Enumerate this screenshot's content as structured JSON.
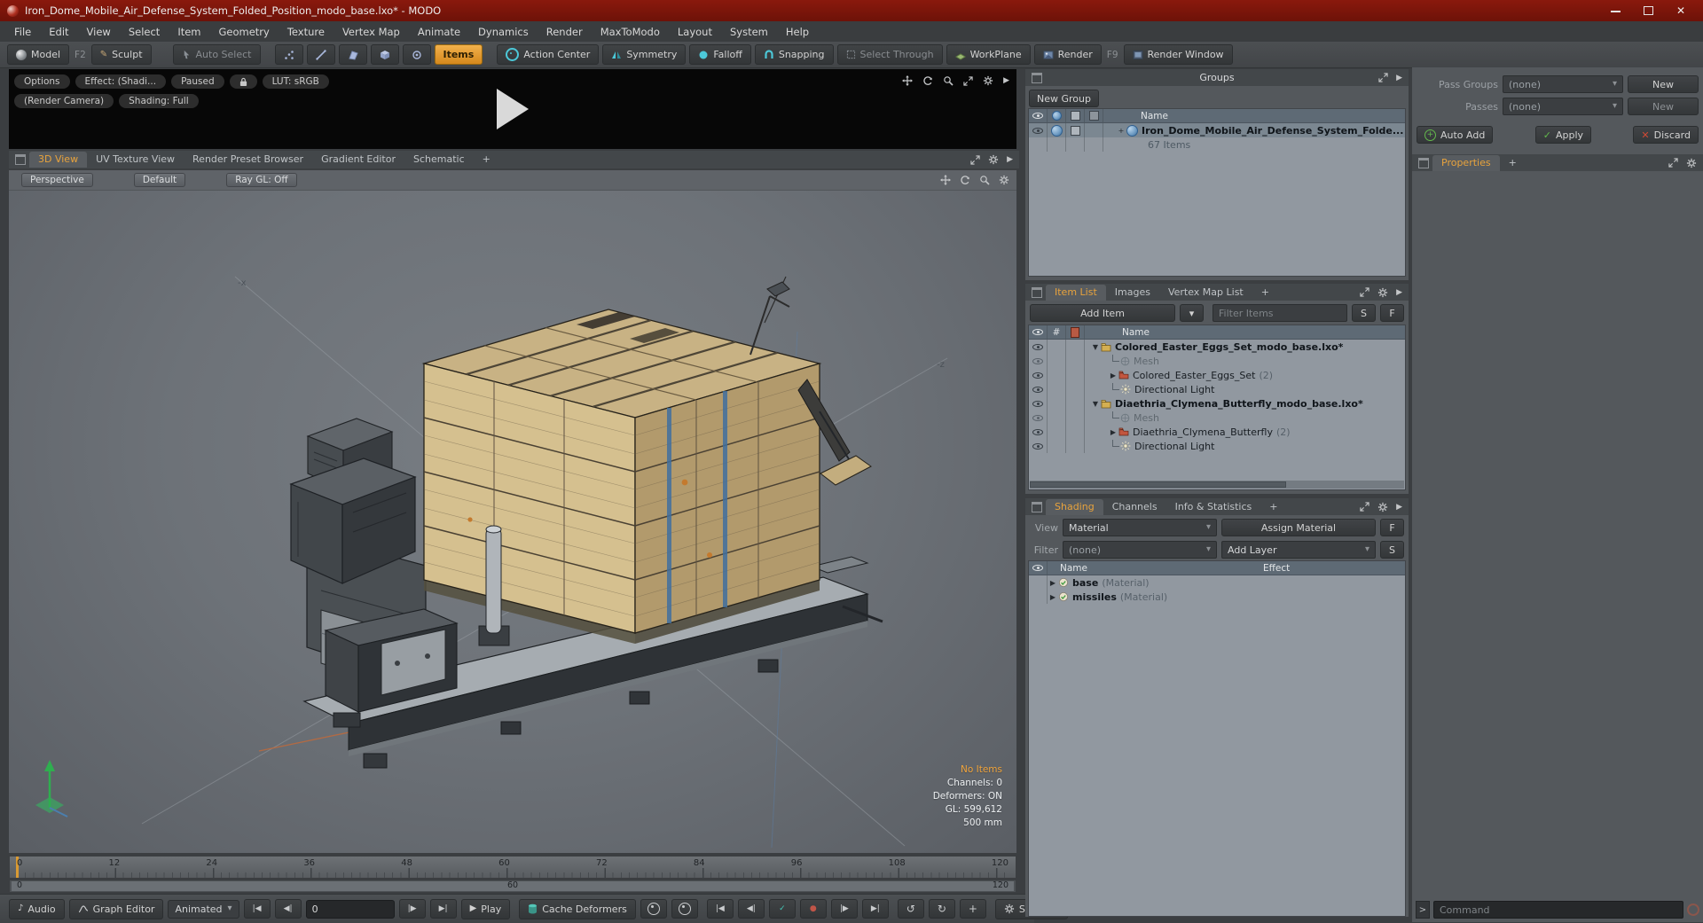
{
  "icons": {
    "close": "✕",
    "dropdown": "▾",
    "caret_down": "▼",
    "caret_right": "▶",
    "menu_expand": "▶",
    "plus": "+",
    "check": "✓",
    "play": "▶",
    "jump_start": "|◀",
    "step_back": "◀|",
    "step_fwd": "|▶",
    "jump_end": "▶|",
    "rotate_cw": "↻",
    "rotate_ccw": "↺",
    "note": "♪",
    "pencil": "✎",
    "record": "●",
    "prompt": ">",
    "hash": "#"
  },
  "colors": {
    "accent_orange": "#e8a33d",
    "titlebar_red": "#7a150d",
    "status_green": "#63b94c",
    "status_red": "#cf4a35",
    "strap_blue": "#3f6f9f"
  },
  "titlebar": {
    "title": "Iron_Dome_Mobile_Air_Defense_System_Folded_Position_modo_base.lxo* - MODO"
  },
  "menubar": {
    "items": [
      "File",
      "Edit",
      "View",
      "Select",
      "Item",
      "Geometry",
      "Texture",
      "Vertex Map",
      "Animate",
      "Dynamics",
      "Render",
      "MaxToModo",
      "Layout",
      "System",
      "Help"
    ]
  },
  "toolbar": {
    "model": "Model",
    "model_key": "F2",
    "sculpt": "Sculpt",
    "auto_select": "Auto Select",
    "items": "Items",
    "action_center": "Action Center",
    "symmetry": "Symmetry",
    "falloff": "Falloff",
    "snapping": "Snapping",
    "select_through": "Select Through",
    "workplane": "WorkPlane",
    "render": "Render",
    "render_key": "F9",
    "render_window": "Render Window"
  },
  "preview": {
    "options": "Options",
    "effect": "Effect: (Shadi...",
    "paused": "Paused",
    "lut": "LUT: sRGB",
    "render_camera": "(Render Camera)",
    "shading": "Shading: Full"
  },
  "viewport": {
    "tabs": [
      "3D View",
      "UV Texture View",
      "Render Preset Browser",
      "Gradient Editor",
      "Schematic",
      "+"
    ],
    "controls": [
      "Perspective",
      "Default",
      "Ray GL: Off"
    ],
    "axis": {
      "x": "-x",
      "z": "-z"
    },
    "hud": {
      "no_items": "No Items",
      "channels": "Channels: 0",
      "deformers": "Deformers: ON",
      "gl": "GL: 599,612",
      "units": "500 mm"
    }
  },
  "timeline": {
    "ticks": [
      "0",
      "12",
      "24",
      "36",
      "48",
      "60",
      "72",
      "84",
      "96",
      "108",
      "120"
    ],
    "range": {
      "start": "0",
      "mid": "60",
      "end": "120"
    }
  },
  "transport": {
    "audio": "Audio",
    "graph_editor": "Graph Editor",
    "animated": "Animated",
    "frame": "0",
    "play": "Play",
    "cache_deformers": "Cache Deformers",
    "settings": "Settings"
  },
  "groups_panel": {
    "title": "Groups",
    "new_group": "New Group",
    "name_header": "Name",
    "row": {
      "name": "Iron_Dome_Mobile_Air_Defense_System_Folde...",
      "count": "67 Items"
    }
  },
  "item_list_panel": {
    "tabs": [
      "Item List",
      "Images",
      "Vertex Map List",
      "+"
    ],
    "add_item": "Add Item",
    "filter_placeholder": "Filter Items",
    "s": "S",
    "f": "F",
    "name_header": "Name",
    "rows": [
      {
        "label": "Colored_Easter_Eggs_Set_modo_base.lxo*",
        "suffix": ""
      },
      {
        "label": "Mesh",
        "suffix": ""
      },
      {
        "label": "Colored_Easter_Eggs_Set",
        "suffix": "(2)"
      },
      {
        "label": "Directional Light",
        "suffix": ""
      },
      {
        "label": "Diaethria_Clymena_Butterfly_modo_base.lxo*",
        "suffix": ""
      },
      {
        "label": "Mesh",
        "suffix": ""
      },
      {
        "label": "Diaethria_Clymena_Butterfly",
        "suffix": "(2)"
      },
      {
        "label": "Directional Light",
        "suffix": ""
      }
    ]
  },
  "shading_panel": {
    "tabs": [
      "Shading",
      "Channels",
      "Info & Statistics",
      "+"
    ],
    "view_label": "View",
    "view_value": "Material",
    "assign_material": "Assign Material",
    "f": "F",
    "filter_label": "Filter",
    "filter_value": "(none)",
    "add_layer": "Add Layer",
    "s": "S",
    "name_header": "Name",
    "effect_header": "Effect",
    "rows": [
      {
        "name": "base",
        "suffix": "(Material)"
      },
      {
        "name": "missiles",
        "suffix": "(Material)"
      }
    ]
  },
  "right_panel": {
    "pass_groups_label": "Pass Groups",
    "pass_groups_value": "(none)",
    "pass_groups_new": "New",
    "passes_label": "Passes",
    "passes_value": "(none)",
    "passes_new": "New",
    "auto_add": "Auto Add",
    "apply": "Apply",
    "discard": "Discard",
    "properties_tab": "Properties",
    "plus": "+",
    "prompt": ">",
    "command_placeholder": "Command"
  }
}
